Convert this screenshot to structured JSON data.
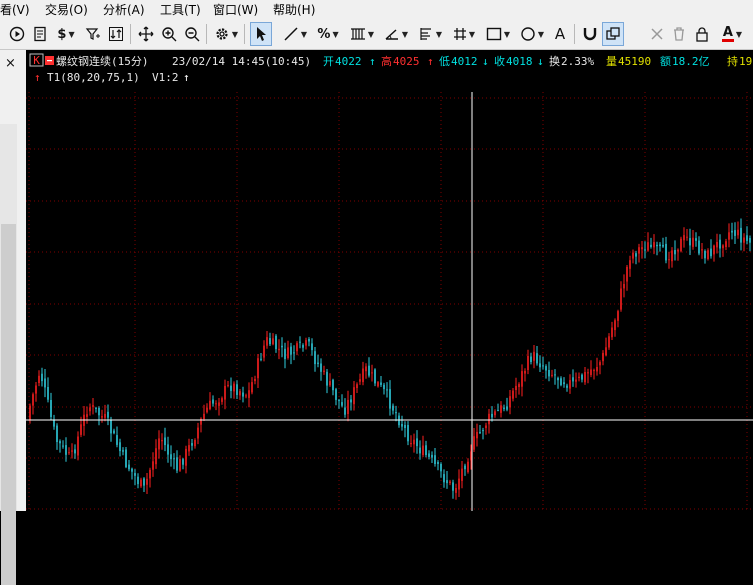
{
  "menubar": {
    "items": [
      "看(V)",
      "交易(O)",
      "分析(A)",
      "工具(T)",
      "窗口(W)",
      "帮助(H)"
    ]
  },
  "toolbar": {
    "icons": [
      "play-circle-icon",
      "notepad-icon",
      "dollar-icon",
      "filter-icon",
      "swap-icon",
      "move-icon",
      "zoom-in-icon",
      "zoom-out-icon",
      "settings-gear-icon",
      "arrow-pointer-icon",
      "line-tool-icon",
      "percent-tool-icon",
      "bar-tool-icon",
      "angle-tool-icon",
      "fib-lines-icon",
      "grid-hash-icon",
      "rectangle-tool-icon",
      "ellipse-tool-icon",
      "text-tool-icon",
      "magnet-icon",
      "copy-layers-icon",
      "delete-icon",
      "trash-icon",
      "lock-icon",
      "lock-alt-icon",
      "font-color-icon",
      "fill-icon"
    ],
    "text_glyphs": {
      "dollar": "$",
      "percent": "%",
      "text_tool": "A",
      "font_color": "A"
    }
  },
  "panel": {
    "close_glyph": "×"
  },
  "chart": {
    "tag": "K",
    "symbol": "螺纹钢连续(15分)",
    "datetime": "23/02/14 14:45(10:45)",
    "open_label": "开",
    "open": "4022",
    "high_label": "高",
    "high": "4025",
    "low_label": "低",
    "low": "4012",
    "close_label": "收",
    "close": "4018",
    "turnover_label": "换",
    "turnover": "2.33%",
    "volume_label": "量",
    "volume": "45190",
    "amount_label": "额",
    "amount": "18.2亿",
    "hold_label": "持",
    "hold": "19",
    "indicator": "T1(80,20,75,1)",
    "indicator_v": "V1:2",
    "arrow_up": "↑",
    "arrow_down": "↓"
  },
  "colors": {
    "up": "#ff2020",
    "down": "#30d0e0",
    "label_cyan": "#00e0e0",
    "label_red": "#ff3030",
    "label_yellow": "#e0e000",
    "info_white": "#e8e8e8",
    "crosshair": "#ffffff",
    "grid": "#800000"
  },
  "chart_data": {
    "type": "candlestick",
    "title": "螺纹钢连续(15分)"
  }
}
